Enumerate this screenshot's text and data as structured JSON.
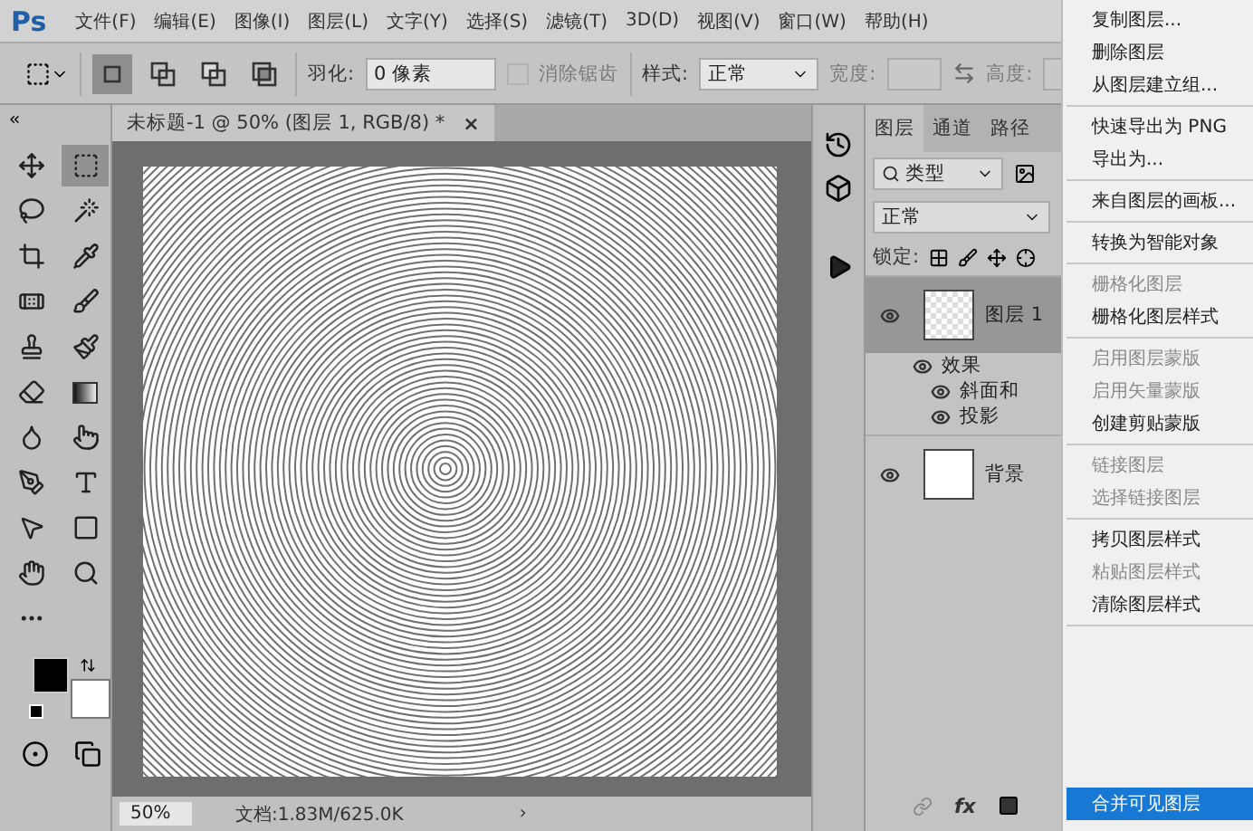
{
  "app_logo": "Ps",
  "menu_bar": [
    "文件(F)",
    "编辑(E)",
    "图像(I)",
    "图层(L)",
    "文字(Y)",
    "选择(S)",
    "滤镜(T)",
    "3D(D)",
    "视图(V)",
    "窗口(W)",
    "帮助(H)"
  ],
  "options_bar": {
    "modes": [
      {
        "kind": "new",
        "selected": true
      },
      {
        "kind": "add",
        "selected": false
      },
      {
        "kind": "subtract",
        "selected": false
      },
      {
        "kind": "intersect",
        "selected": false
      }
    ],
    "feather": {
      "label": "羽化:",
      "value": "0 像素"
    },
    "anti_alias": {
      "label": "消除锯齿",
      "checked": false,
      "disabled": true
    },
    "style": {
      "label": "样式:",
      "value": "正常"
    },
    "width": {
      "label": "宽度:",
      "disabled": true
    },
    "height": {
      "label": "高度:",
      "disabled": true
    }
  },
  "tools": [
    {
      "kind": "move",
      "selected": false
    },
    {
      "kind": "marquee",
      "selected": true
    },
    {
      "kind": "lasso",
      "selected": false
    },
    {
      "kind": "wand",
      "selected": false
    },
    {
      "kind": "crop",
      "selected": false
    },
    {
      "kind": "eyedropper",
      "selected": false
    },
    {
      "kind": "heal",
      "selected": false
    },
    {
      "kind": "brush",
      "selected": false
    },
    {
      "kind": "stamp",
      "selected": false
    },
    {
      "kind": "history",
      "selected": false
    },
    {
      "kind": "eraser",
      "selected": false
    },
    {
      "kind": "gradient",
      "selected": false
    },
    {
      "kind": "blur",
      "selected": false
    },
    {
      "kind": "smudge",
      "selected": false
    },
    {
      "kind": "pen",
      "selected": false
    },
    {
      "kind": "type",
      "selected": false
    },
    {
      "kind": "select",
      "selected": false
    },
    {
      "kind": "shape",
      "selected": false
    },
    {
      "kind": "hand",
      "selected": false
    },
    {
      "kind": "zoom",
      "selected": false
    },
    {
      "kind": "more",
      "selected": false
    }
  ],
  "document": {
    "tab_title": "未标题-1 @ 50% (图层 1, RGB/8) *",
    "close": "×",
    "zoom": "50%",
    "doc_info": "文档:1.83M/625.0K",
    "more": "›"
  },
  "layers_panel": {
    "tabs": [
      {
        "label": "图层",
        "selected": true
      },
      {
        "label": "通道",
        "selected": false
      },
      {
        "label": "路径",
        "selected": false
      }
    ],
    "filter": "类型",
    "blend_mode": "正常",
    "lock_label": "锁定:",
    "layers": [
      {
        "name": "图层 1",
        "selected": true,
        "visible": true,
        "kind": "transparent",
        "effects": {
          "label": "效果",
          "visible": true,
          "items": [
            {
              "name": "斜面和",
              "visible": true
            },
            {
              "name": "投影",
              "visible": true
            }
          ]
        }
      },
      {
        "name": "背景",
        "selected": false,
        "visible": true,
        "kind": "white"
      }
    ],
    "footer_fx": "fx"
  },
  "context_menu": [
    [
      {
        "label": "复制图层...",
        "disabled": false,
        "selected": false
      },
      {
        "label": "删除图层",
        "disabled": false,
        "selected": false
      },
      {
        "label": "从图层建立组...",
        "disabled": false,
        "selected": false
      }
    ],
    [
      {
        "label": "快速导出为 PNG",
        "disabled": false,
        "selected": false
      },
      {
        "label": "导出为...",
        "disabled": false,
        "selected": false
      }
    ],
    [
      {
        "label": "来自图层的画板...",
        "disabled": false,
        "selected": false
      }
    ],
    [
      {
        "label": "转换为智能对象",
        "disabled": false,
        "selected": false
      }
    ],
    [
      {
        "label": "栅格化图层",
        "disabled": true,
        "selected": false
      },
      {
        "label": "栅格化图层样式",
        "disabled": false,
        "selected": false
      }
    ],
    [
      {
        "label": "启用图层蒙版",
        "disabled": true,
        "selected": false
      },
      {
        "label": "启用矢量蒙版",
        "disabled": true,
        "selected": false
      },
      {
        "label": "创建剪贴蒙版",
        "disabled": false,
        "selected": false
      }
    ],
    [
      {
        "label": "链接图层",
        "disabled": true,
        "selected": false
      },
      {
        "label": "选择链接图层",
        "disabled": true,
        "selected": false
      }
    ],
    [
      {
        "label": "拷贝图层样式",
        "disabled": false,
        "selected": false
      },
      {
        "label": "粘贴图层样式",
        "disabled": true,
        "selected": false
      },
      {
        "label": "清除图层样式",
        "disabled": false,
        "selected": false
      }
    ],
    [
      {
        "label": "合并可见图层",
        "disabled": false,
        "selected": true
      }
    ]
  ]
}
